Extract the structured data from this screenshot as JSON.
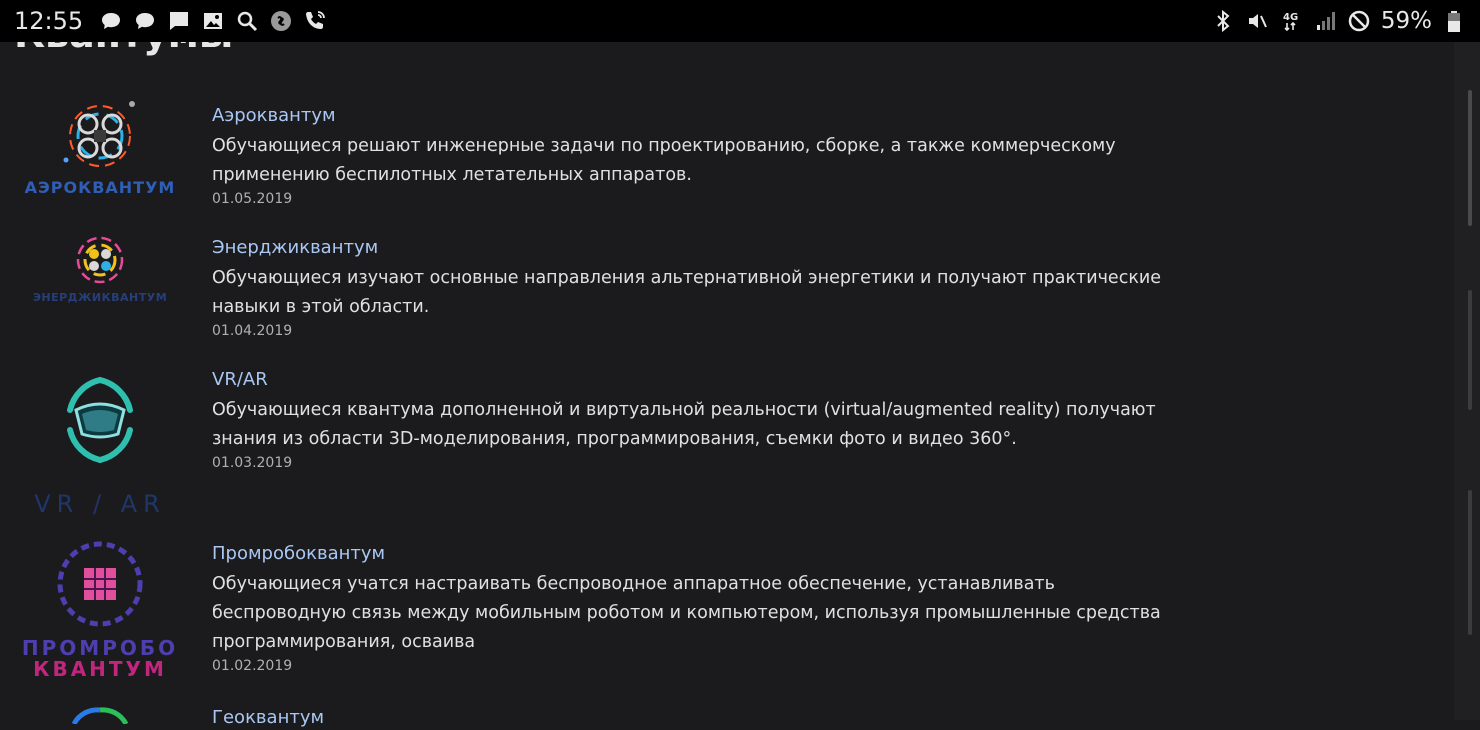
{
  "status_bar": {
    "time": "12:55",
    "battery": "59%",
    "network": "4G",
    "left_icons": [
      "message-icon",
      "message-icon",
      "chat-icon",
      "image-icon",
      "search-icon",
      "shazam-icon",
      "wifi-call-icon"
    ],
    "right_icons": [
      "bluetooth-icon",
      "vibrate-icon",
      "network-4g-icon",
      "signal-icon",
      "no-sim-icon",
      "battery-icon"
    ]
  },
  "page": {
    "title": "Квантумы"
  },
  "items": [
    {
      "title": "Аэроквантум",
      "description_lines": [
        "Обучающиеся решают инженерные задачи по проектированию, сборке, а также коммерческому",
        "применению беспилотных летательных аппаратов."
      ],
      "date": "01.05.2019",
      "logo_text": "АЭРОКВАНТУМ",
      "logo_color": "#2f5eb6"
    },
    {
      "title": "Энерджиквантум",
      "description_lines": [
        "Обучающиеся изучают основные направления альтернативной энергетики и получают практические",
        "навыки в этой области."
      ],
      "date": "01.04.2019",
      "logo_text": "ЭНЕРДЖИКВАНТУМ",
      "logo_color": "#263f7a"
    },
    {
      "title": "VR/AR",
      "description_lines": [
        "Обучающиеся квантума дополненной и виртуальной реальности (virtual/augmented reality) получают",
        "знания из области 3D-моделирования, программирования, съемки фото и видео 360°."
      ],
      "date": "01.03.2019",
      "logo_text": "VR / AR",
      "logo_color": "#1f3768"
    },
    {
      "title": "Промробоквантум",
      "description_lines": [
        "Обучающиеся учатся настраивать беспроводное аппаратное обеспечение, устанавливать",
        "беспроводную связь между мобильным роботом и компьютером, используя промышленные средства",
        "программирования, осваива"
      ],
      "date": "01.02.2019",
      "logo_text_line1": "ПРОМРОБО",
      "logo_text_line2": "КВАНТУМ",
      "logo_color": "#4d3fb0",
      "logo_color2": "#c0267e"
    },
    {
      "title": "Геоквантум"
    }
  ]
}
